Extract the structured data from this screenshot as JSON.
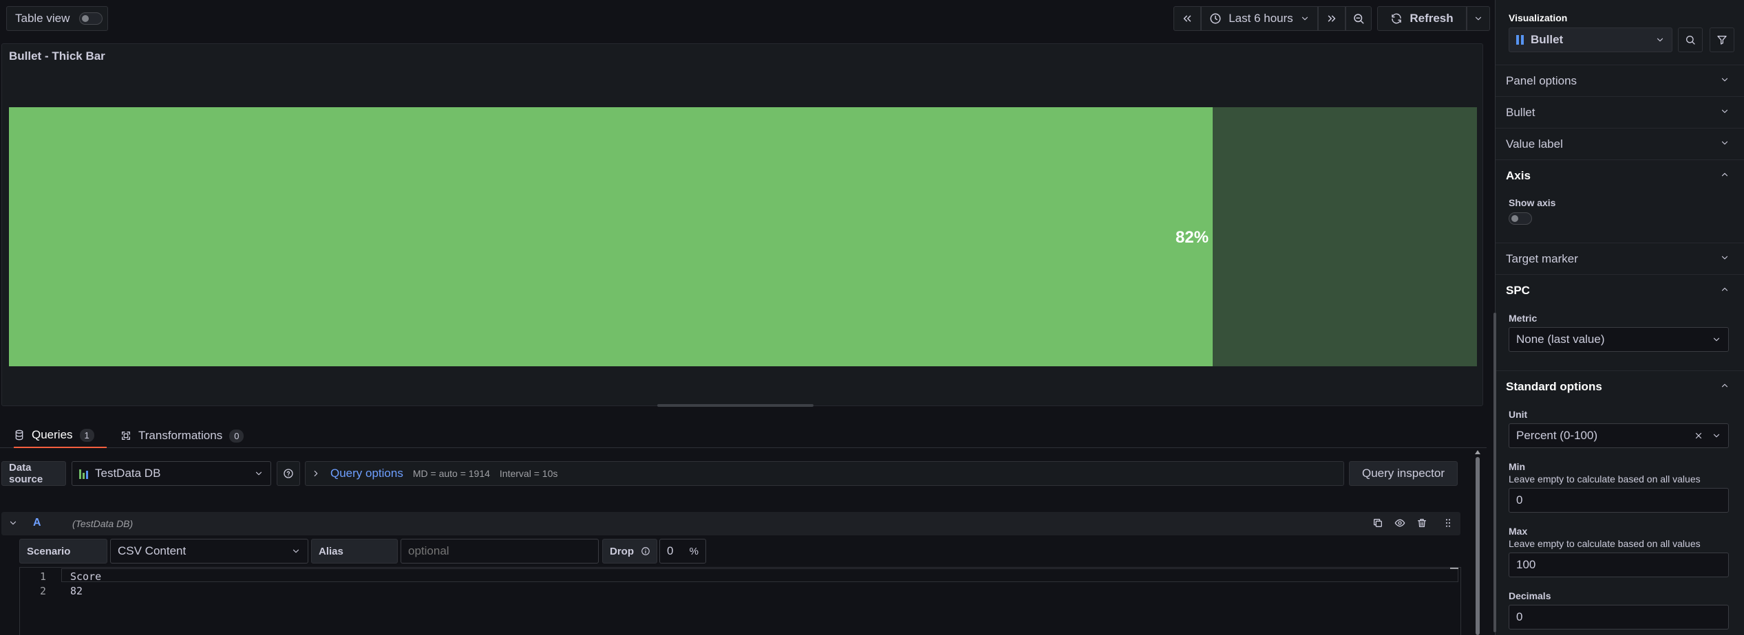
{
  "toolbar": {
    "table_view_label": "Table view",
    "time_range": "Last 6 hours",
    "refresh_label": "Refresh"
  },
  "panel": {
    "title": "Bullet - Thick Bar",
    "value_label": "82%",
    "value_fraction": 0.82,
    "colors": {
      "fill": "#73bf69",
      "track": "#37513a"
    }
  },
  "tabs": {
    "queries_label": "Queries",
    "queries_count": "1",
    "transformations_label": "Transformations",
    "transformations_count": "0"
  },
  "query": {
    "datasource_label": "Data source",
    "datasource_value": "TestData DB",
    "query_options_label": "Query options",
    "md_text": "MD = auto = 1914",
    "interval_text": "Interval = 10s",
    "inspector_label": "Query inspector",
    "row_ref": "A",
    "row_ds": "(TestData DB)",
    "scenario_label": "Scenario",
    "scenario_value": "CSV Content",
    "alias_label": "Alias",
    "alias_placeholder": "optional",
    "drop_label": "Drop",
    "drop_value": "0",
    "drop_unit": "%",
    "code_lines": [
      {
        "num": "1",
        "text": "Score"
      },
      {
        "num": "2",
        "text": "82"
      }
    ]
  },
  "sidebar": {
    "visualization_label": "Visualization",
    "visualization_value": "Bullet",
    "sections": {
      "panel_options": "Panel options",
      "bullet": "Bullet",
      "value_label": "Value label",
      "axis": "Axis",
      "target_marker": "Target marker",
      "spc": "SPC",
      "standard_options": "Standard options"
    },
    "show_axis_label": "Show axis",
    "metric_label": "Metric",
    "metric_value": "None (last value)",
    "unit_label": "Unit",
    "unit_value": "Percent (0-100)",
    "min_label": "Min",
    "min_desc": "Leave empty to calculate based on all values",
    "min_value": "0",
    "max_label": "Max",
    "max_desc": "Leave empty to calculate based on all values",
    "max_value": "100",
    "decimals_label": "Decimals",
    "decimals_value": "0"
  }
}
